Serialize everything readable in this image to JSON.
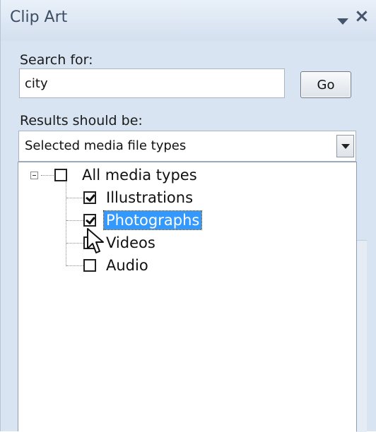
{
  "pane": {
    "title": "Clip Art",
    "search_label": "Search for:",
    "search_value": "city",
    "go_label": "Go",
    "results_label": "Results should be:",
    "results_selected": "Selected media file types"
  },
  "tree": {
    "root": {
      "label": "All media types",
      "checked": false
    },
    "items": [
      {
        "label": "Illustrations",
        "checked": true
      },
      {
        "label": "Photographs",
        "checked": true,
        "selected": true
      },
      {
        "label": "Videos",
        "checked": false
      },
      {
        "label": "Audio",
        "checked": false
      }
    ]
  },
  "icons": {
    "menu": "chevron-down-icon",
    "close": "close-icon",
    "cursor": "mouse-pointer-icon"
  },
  "colors": {
    "pane_bg": "#d9e4f2",
    "selection": "#3399ff"
  }
}
